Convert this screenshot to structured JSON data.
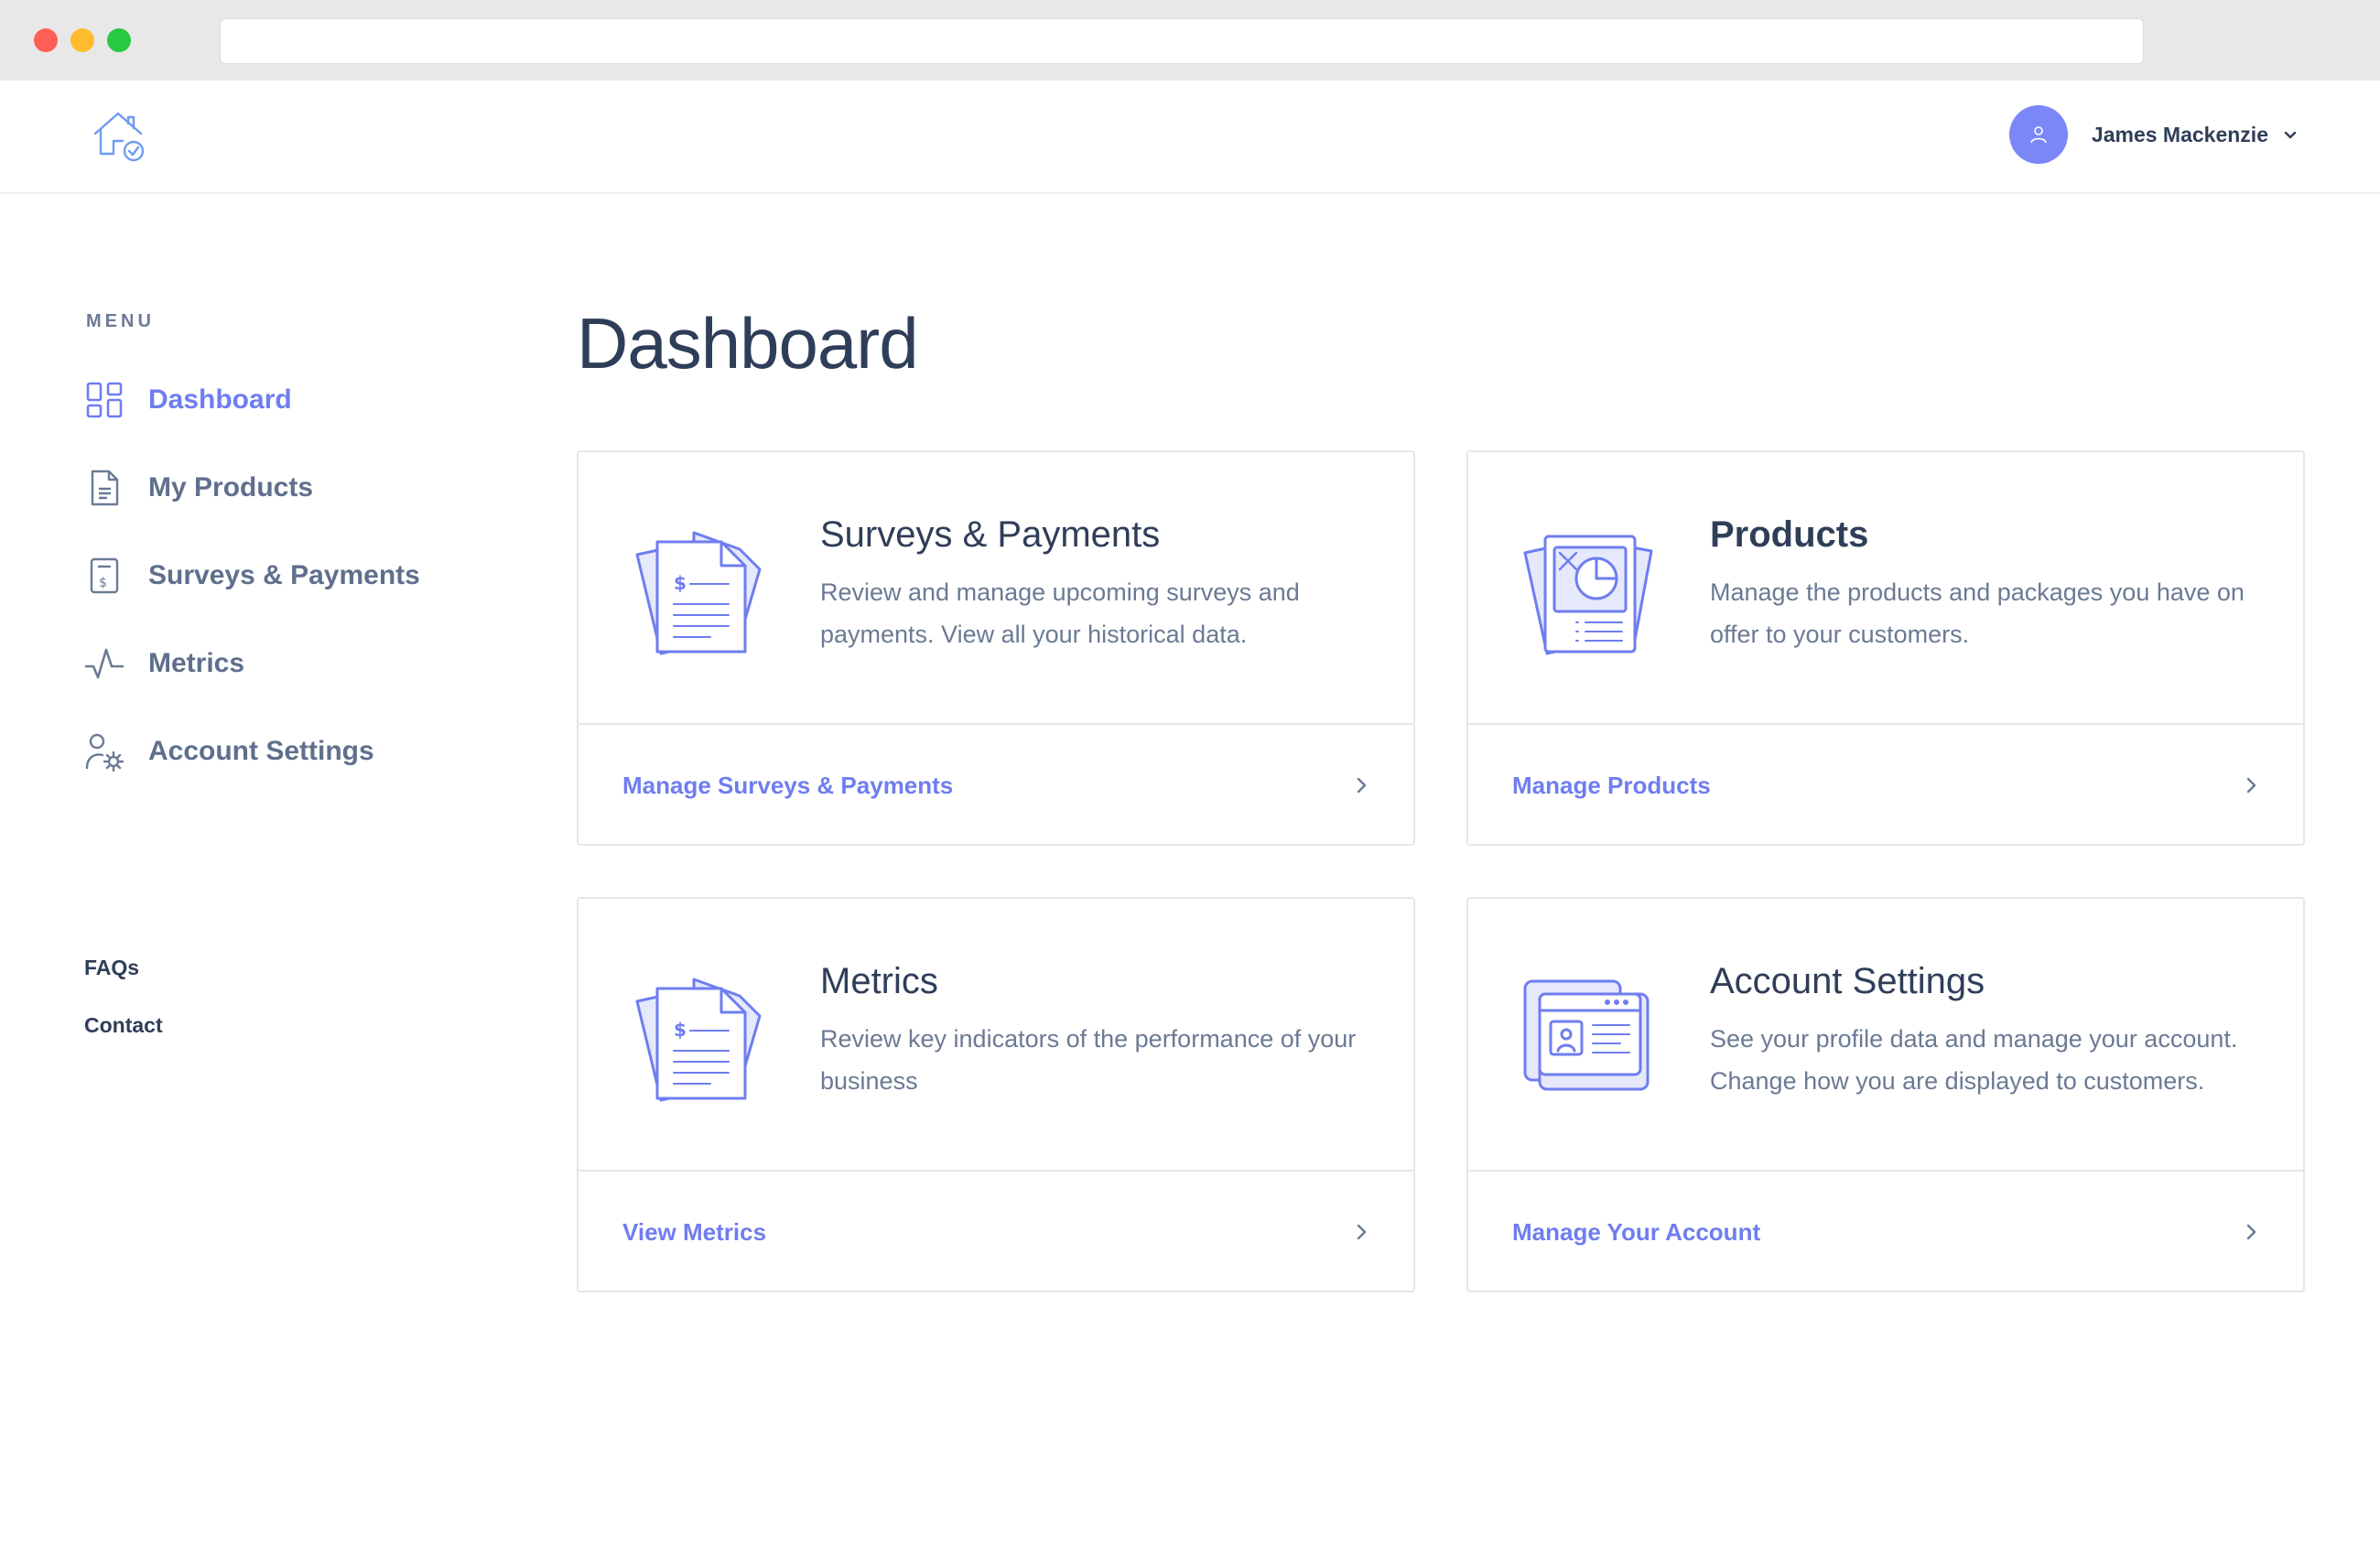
{
  "header": {
    "user_name": "James Mackenzie"
  },
  "sidebar": {
    "heading": "MENU",
    "items": [
      {
        "label": "Dashboard",
        "icon": "grid-icon",
        "active": true
      },
      {
        "label": "My Products",
        "icon": "document-icon",
        "active": false
      },
      {
        "label": "Surveys & Payments",
        "icon": "receipt-icon",
        "active": false
      },
      {
        "label": "Metrics",
        "icon": "pulse-icon",
        "active": false
      },
      {
        "label": "Account Settings",
        "icon": "user-gear-icon",
        "active": false
      }
    ],
    "links": [
      {
        "label": "FAQs"
      },
      {
        "label": "Contact"
      }
    ]
  },
  "main": {
    "title": "Dashboard",
    "cards": [
      {
        "title": "Surveys & Payments",
        "description": "Review and manage upcoming surveys and payments. View all your historical data.",
        "link": "Manage Surveys & Payments",
        "icon": "invoice-documents-icon"
      },
      {
        "title": "Products",
        "description": "Manage the products and packages you have on offer to your customers.",
        "link": "Manage Products",
        "icon": "report-documents-icon"
      },
      {
        "title": "Metrics",
        "description": "Review key indicators of the performance of your business",
        "link": "View Metrics",
        "icon": "invoice-documents-icon"
      },
      {
        "title": "Account Settings",
        "description": "See your profile data and manage your account. Change how you are displayed to customers.",
        "link": "Manage Your Account",
        "icon": "profile-windows-icon"
      }
    ]
  },
  "colors": {
    "accent": "#6f7df0",
    "text_dark": "#2f3e58",
    "text_muted": "#6b7a94",
    "border": "#e3e7ee"
  }
}
